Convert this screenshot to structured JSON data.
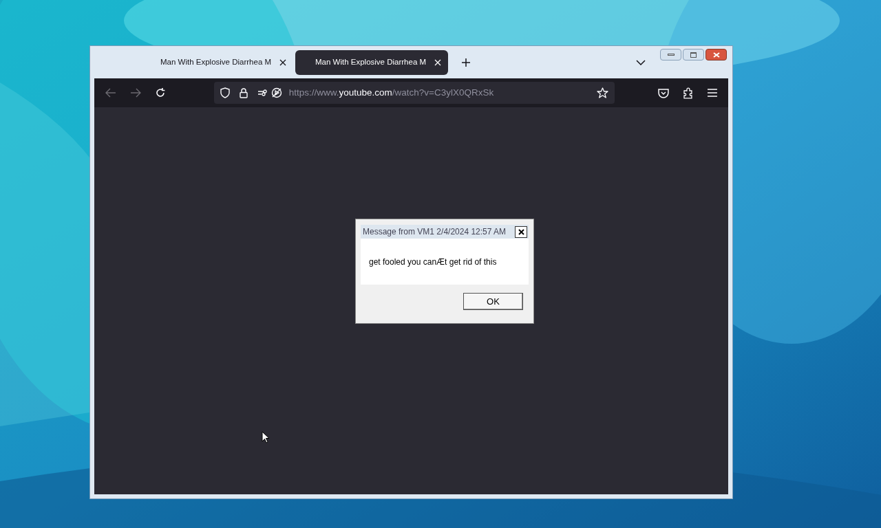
{
  "browser": {
    "tabs": [
      {
        "title": "Man With Explosive Diarrhea M",
        "selected": false
      },
      {
        "title": "Man With Explosive Diarrhea M",
        "selected": true
      }
    ],
    "address": {
      "prefix": "https://www.",
      "domain": "youtube.com",
      "path": "/watch?v=C3ylX0QRxSk"
    }
  },
  "dialog": {
    "title": "Message from VM1 2/4/2024 12:57 AM",
    "message": "get fooled you canÆt get rid of this",
    "button": "OK"
  }
}
